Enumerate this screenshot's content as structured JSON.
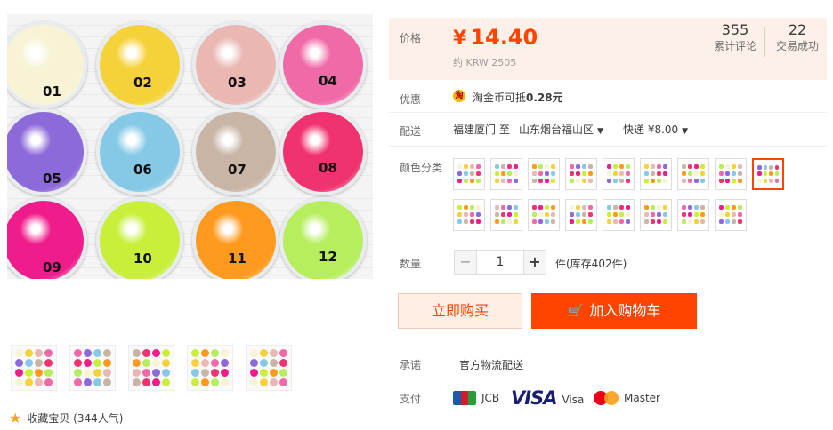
{
  "gallery": {
    "jar_labels": [
      "01",
      "02",
      "03",
      "04",
      "05",
      "06",
      "07",
      "08",
      "09",
      "10",
      "11",
      "12"
    ],
    "jar_colors": [
      "#f7f3d4",
      "#f6d23a",
      "#eab7b3",
      "#f06aa8",
      "#8d6ad9",
      "#86c9e6",
      "#c9b5a6",
      "#f0336f",
      "#f01c8c",
      "#c9ef3a",
      "#ff9a1f",
      "#b6ee5e"
    ],
    "favorite_label": "收藏宝贝 (344人气)"
  },
  "price": {
    "label": "价格",
    "currency": "¥",
    "amount": "14.40",
    "krw": "约 KRW 2505",
    "reviews_count": "355",
    "reviews_label": "累计评论",
    "sales_count": "22",
    "sales_label": "交易成功"
  },
  "promotion": {
    "label": "优惠",
    "icon_text": "淘",
    "text": "淘金币可抵",
    "value": "0.28元"
  },
  "shipping": {
    "label": "配送",
    "from": "福建厦门 至",
    "to": "山东烟台福山区",
    "method": "快递 ¥8.00"
  },
  "color": {
    "label": "颜色分类"
  },
  "quantity": {
    "label": "数量",
    "minus": "−",
    "value": "1",
    "plus": "+",
    "stock": "件(库存402件)"
  },
  "actions": {
    "buy_now": "立即购买",
    "add_to_cart": "加入购物车"
  },
  "promise": {
    "label": "承诺",
    "text": "官方物流配送"
  },
  "payment": {
    "label": "支付",
    "jcb": "JCB",
    "visa_logo": "VISA",
    "visa": "Visa",
    "mastercard": "Master"
  },
  "colors": {
    "accent": "#ff4400",
    "price_bg": "#fdf0e8"
  }
}
